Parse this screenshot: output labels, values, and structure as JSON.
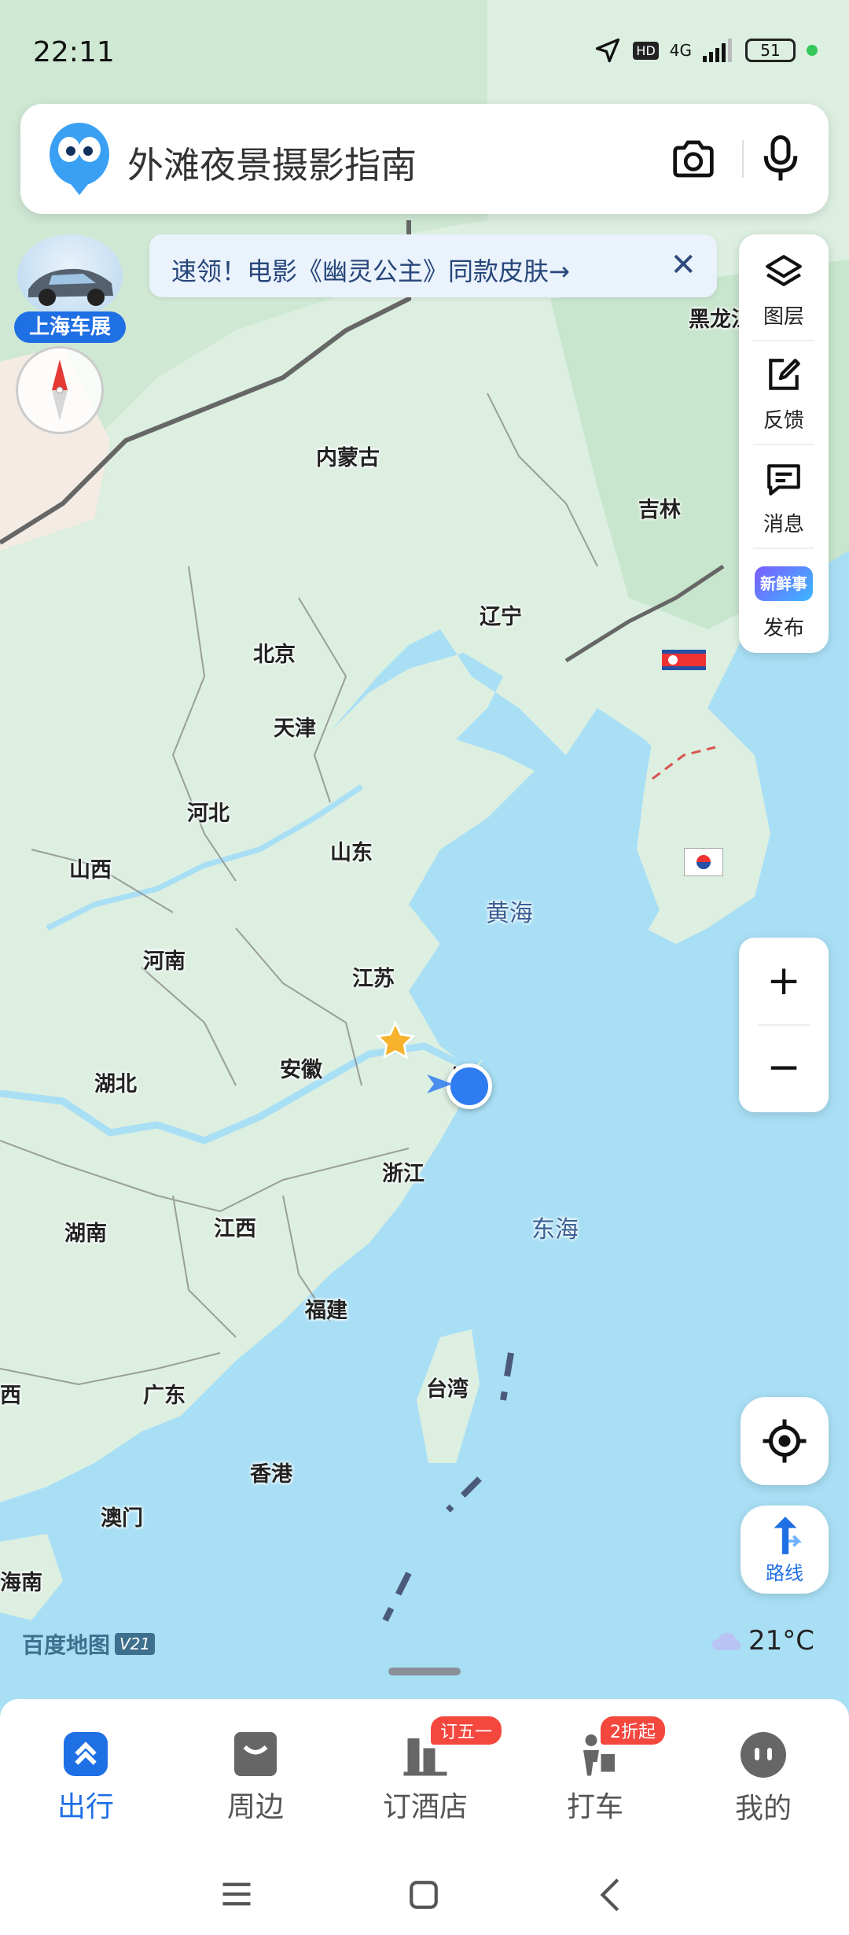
{
  "status_bar": {
    "time": "22:11",
    "hd_badge": "HD",
    "network": "4G",
    "battery": "51"
  },
  "search": {
    "query": "外滩夜景摄影指南"
  },
  "promo": {
    "text": "速领！电影《幽灵公主》同款皮肤→"
  },
  "car_show_badge": "上海车展",
  "toolbar": {
    "items": [
      {
        "label": "图层",
        "icon": "layers-icon"
      },
      {
        "label": "反馈",
        "icon": "feedback-edit-icon"
      },
      {
        "label": "消息",
        "icon": "message-icon"
      },
      {
        "label": "发布",
        "icon": "new-event-icon",
        "badge": "新鲜事"
      }
    ]
  },
  "map": {
    "provinces": [
      "黑龙江",
      "内蒙古",
      "吉林",
      "辽宁",
      "北京",
      "天津",
      "河北",
      "山西",
      "山东",
      "河南",
      "江苏",
      "安徽",
      "湖北",
      "浙江",
      "湖南",
      "江西",
      "福建",
      "广东",
      "台湾",
      "香港",
      "澳门",
      "海南",
      "西",
      "上"
    ],
    "seas": [
      "黄海",
      "东海"
    ]
  },
  "map_footer": {
    "brand": "百度地图",
    "version": "V21",
    "temperature": "21°C"
  },
  "route_label": "路线",
  "bottom_nav": [
    {
      "label": "出行",
      "active": true,
      "icon": "travel-icon"
    },
    {
      "label": "周边",
      "active": false,
      "icon": "nearby-icon"
    },
    {
      "label": "订酒店",
      "active": false,
      "icon": "hotel-icon",
      "badge": "订五一"
    },
    {
      "label": "打车",
      "active": false,
      "icon": "taxi-icon",
      "badge": "2折起"
    },
    {
      "label": "我的",
      "active": false,
      "icon": "profile-icon"
    }
  ],
  "colors": {
    "accent": "#1f6fe5",
    "sea": "#a9dff5",
    "land": "#dcefe1",
    "badge_red": "#f4483f"
  }
}
